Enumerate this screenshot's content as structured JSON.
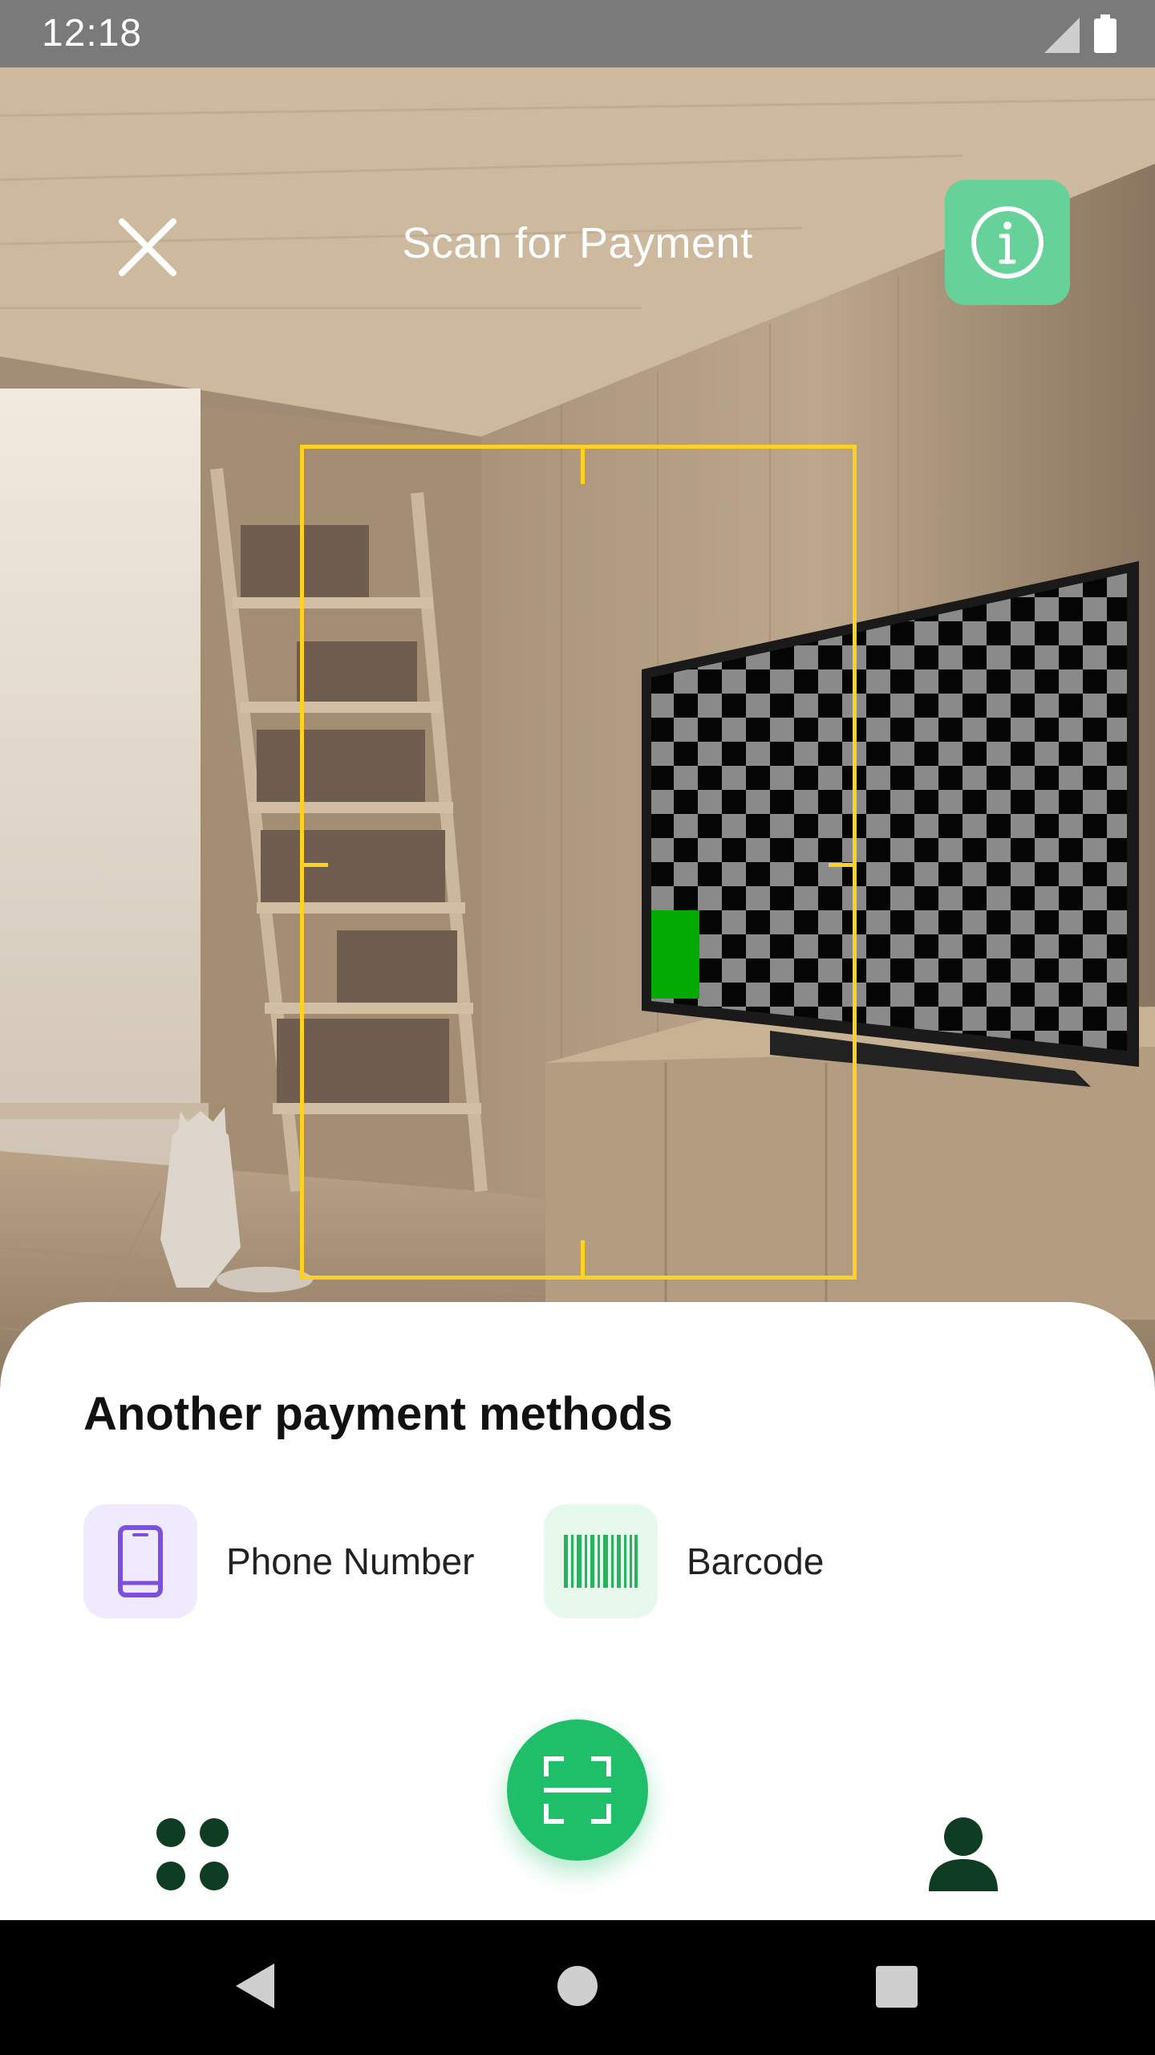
{
  "status_bar": {
    "time": "12:18",
    "icons": [
      "signal-icon",
      "battery-icon"
    ]
  },
  "header": {
    "title": "Scan for Payment",
    "close_icon": "close-icon",
    "info_icon": "info-icon"
  },
  "colors": {
    "scan_frame": "#ffd21f",
    "info_button": "#66d29a",
    "fab": "#1fbf6a",
    "phone_icon": "#7b4fe0",
    "barcode_icon": "#27b35e",
    "nav_icon": "#0f3d24"
  },
  "sheet": {
    "title": "Another payment methods",
    "methods": [
      {
        "label": "Phone Number",
        "icon": "phone-icon"
      },
      {
        "label": "Barcode",
        "icon": "barcode-icon"
      }
    ]
  },
  "bottom_nav": {
    "left_icon": "apps-grid-icon",
    "center_icon": "scan-icon",
    "right_icon": "profile-icon"
  },
  "system_nav": {
    "icons": [
      "back-icon",
      "home-icon",
      "recents-icon"
    ]
  }
}
